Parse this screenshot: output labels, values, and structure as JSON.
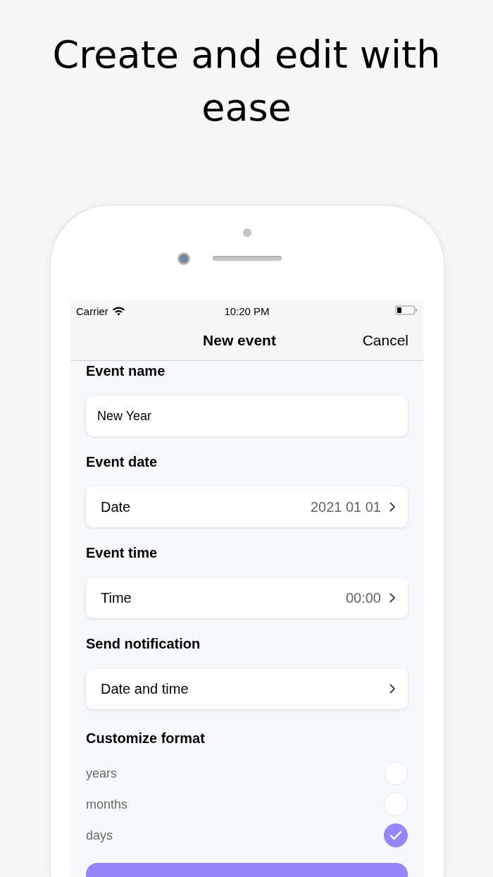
{
  "headline": "Create and edit with ease",
  "status_bar": {
    "carrier": "Carrier",
    "time": "10:20 PM"
  },
  "nav": {
    "title": "New event",
    "cancel": "Cancel"
  },
  "sections": [
    {
      "title": "Event name",
      "kind": "text",
      "value": "New Year"
    },
    {
      "title": "Event date",
      "kind": "picker",
      "label": "Date",
      "value": "2021 01 01"
    },
    {
      "title": "Event time",
      "kind": "picker",
      "label": "Time",
      "value": "00:00"
    },
    {
      "title": "Send notification",
      "kind": "picker",
      "label": "Date and time"
    }
  ],
  "format": {
    "title": "Customize format",
    "options": [
      {
        "label": "years",
        "checked": false
      },
      {
        "label": "months",
        "checked": false
      },
      {
        "label": "days",
        "checked": true
      }
    ]
  }
}
